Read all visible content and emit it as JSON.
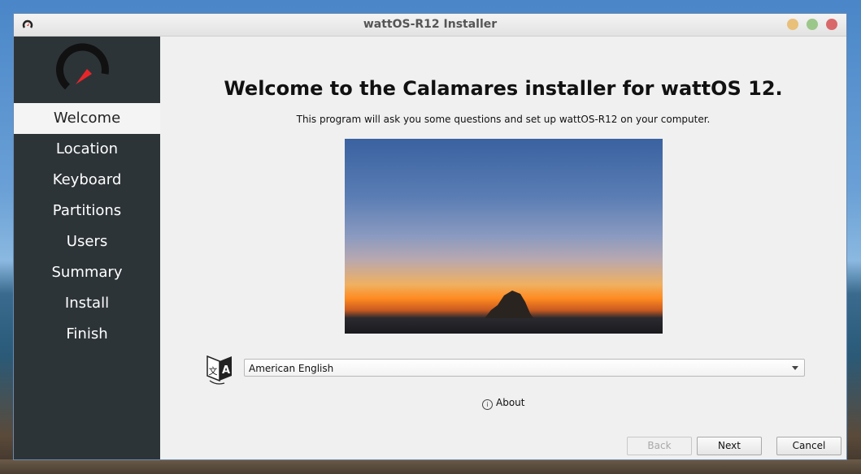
{
  "window": {
    "title": "wattOS-R12 Installer"
  },
  "sidebar": {
    "items": [
      {
        "label": "Welcome",
        "active": true
      },
      {
        "label": "Location",
        "active": false
      },
      {
        "label": "Keyboard",
        "active": false
      },
      {
        "label": "Partitions",
        "active": false
      },
      {
        "label": "Users",
        "active": false
      },
      {
        "label": "Summary",
        "active": false
      },
      {
        "label": "Install",
        "active": false
      },
      {
        "label": "Finish",
        "active": false
      }
    ]
  },
  "main": {
    "heading": "Welcome to the Calamares installer for wattOS 12.",
    "subheading": "This program will ask you some questions and set up wattOS-R12 on your computer.",
    "language_select": {
      "selected": "American English"
    },
    "about_label": "About"
  },
  "buttons": {
    "back_label": "Back",
    "next_label": "Next",
    "cancel_label": "Cancel"
  },
  "icons": {
    "app": "calamares-gauge-icon",
    "language": "language-translate-icon",
    "about": "info-icon"
  },
  "colors": {
    "sidebar_bg": "#2d3438",
    "accent_red": "#e8262a",
    "close": "#d9686a",
    "minimize": "#e8c07a",
    "maximize": "#9cc78a"
  }
}
